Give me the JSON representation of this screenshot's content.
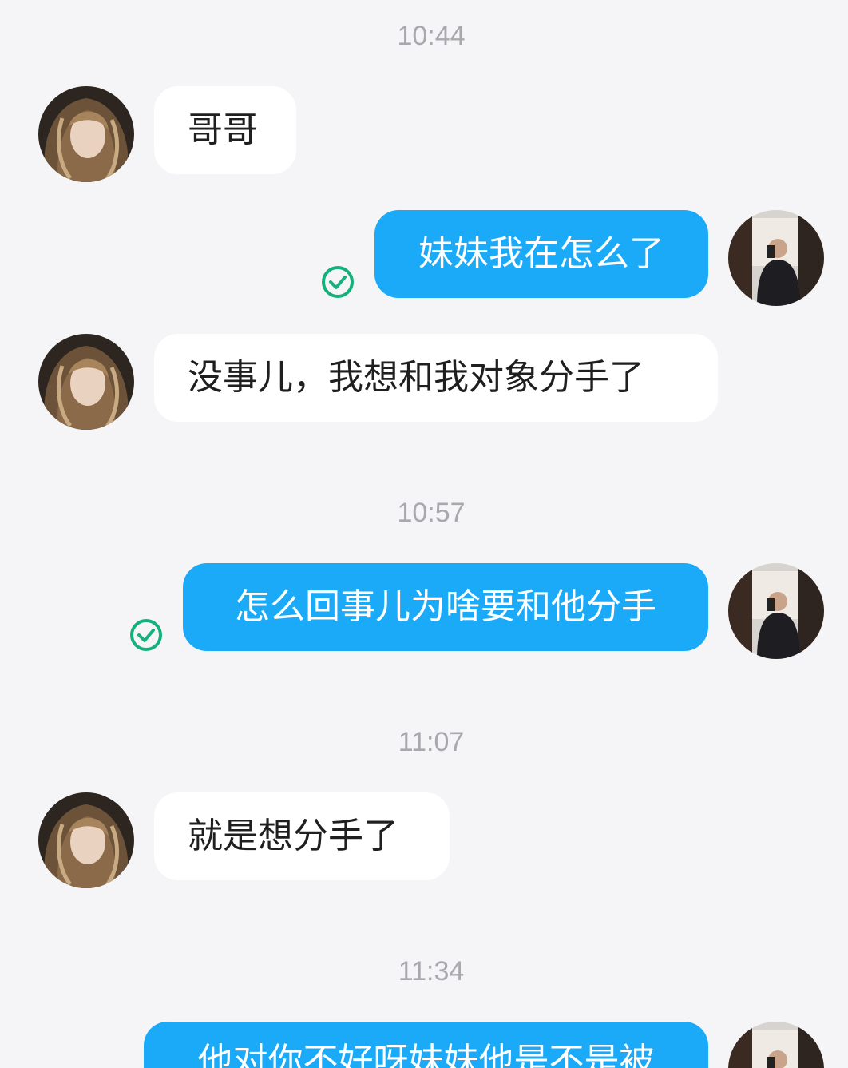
{
  "timestamps": [
    "10:44",
    "10:57",
    "11:07",
    "11:34"
  ],
  "messages": [
    {
      "from": "her",
      "text": "哥哥"
    },
    {
      "from": "me",
      "text": "妹妹我在怎么了",
      "status": "read"
    },
    {
      "from": "her",
      "text": "没事儿，我想和我对象分手了"
    },
    {
      "from": "me",
      "text": "怎么回事儿为啥要和他分手",
      "status": "read"
    },
    {
      "from": "her",
      "text": "就是想分手了"
    },
    {
      "from": "me",
      "text": "他对你不好呀妹妹他是不是被"
    }
  ],
  "icons": {
    "read_receipt": "check-circle-icon",
    "avatar_her": "contact-avatar",
    "avatar_me": "self-avatar"
  },
  "colors": {
    "background": "#f5f5f7",
    "incoming_bubble": "#ffffff",
    "outgoing_bubble": "#1aaaf8",
    "timestamp_text": "#a9a9ad",
    "read_check": "#14b27a"
  }
}
